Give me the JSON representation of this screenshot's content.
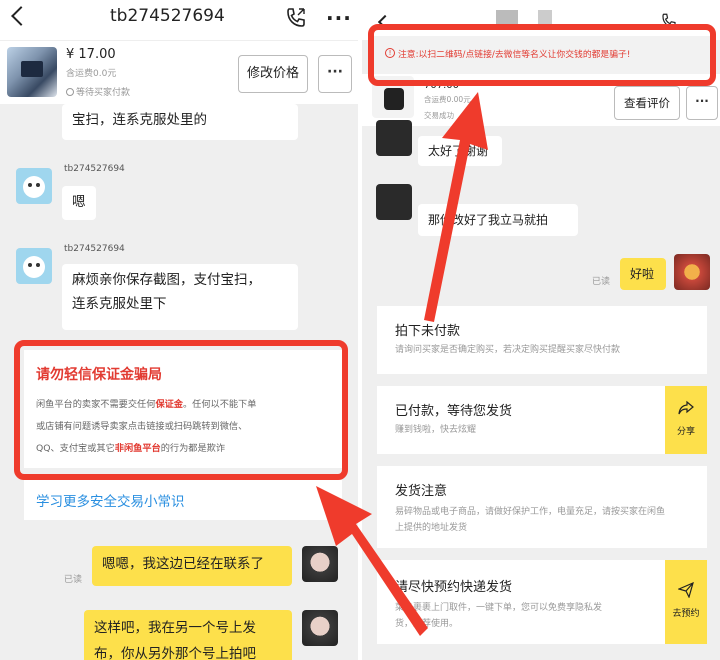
{
  "left": {
    "chat_title": "tb274527694",
    "product": {
      "price": "¥ 17.00",
      "shipping": "含运费0.0元",
      "status": "等待买家付款",
      "edit_price_label": "修改价格",
      "more_label": "···"
    },
    "messages": [
      {
        "text": "宝扫，连系克服处里的"
      },
      {
        "sender": "tb274527694",
        "text": "嗯"
      },
      {
        "sender": "tb274527694",
        "line1": "麻烦亲你保存截图，支付宝扫，",
        "line2": "连系克服处里下"
      }
    ],
    "warning": {
      "title": "请勿轻信保证金骗局",
      "line1_a": "闲鱼平台的卖家不需要交任何",
      "line1_b": "保证金",
      "line1_c": "。任何以不能下单",
      "line2": "或店铺有问题诱导卖家点击链接或扫码跳转到微信、",
      "line3_a": "QQ、支付宝或其它",
      "line3_b": "非闲鱼平台",
      "line3_c": "的行为都是欺诈"
    },
    "learn_more": "学习更多安全交易小常识",
    "my_messages": [
      {
        "read": "已读",
        "text": "嗯嗯，我这边已经在联系了"
      },
      {
        "line1": "这样吧，我在另一个号上发",
        "line2": "布，你从另外那个号上拍吧"
      }
    ]
  },
  "right": {
    "banner": "注意:以扫二维码/点链接/去微信等名义让你交钱的都是骗子!",
    "product": {
      "price": "707.00",
      "shipping": "含运费0.00元",
      "status": "交易成功",
      "review_label": "查看评价",
      "more_label": "···"
    },
    "messages": [
      {
        "text": "太好了谢谢"
      },
      {
        "text": "那你改好了我立马就拍"
      },
      {
        "read": "已读",
        "text": "好啦"
      }
    ],
    "cards": [
      {
        "title": "拍下未付款",
        "desc": "请询问买家是否确定购买，若决定购买提醒买家尽快付款"
      },
      {
        "title": "已付款，等待您发货",
        "desc": "赚到钱啦，快去炫耀",
        "action": "分享"
      },
      {
        "title": "发货注意",
        "desc1": "易碎物品或电子商品，请做好保护工作，电量充足，请按买家在闲鱼",
        "desc2": "上提供的地址发货"
      },
      {
        "title": "请尽快预约快递发货",
        "desc1": "菜鸟裹裹上门取件，一键下单，您可以免费享隐私发",
        "desc2": "货，推荐使用。",
        "action": "去预约"
      }
    ]
  },
  "colors": {
    "annotation_red": "#ef3b2c",
    "warning_red": "#e23b32",
    "bubble_yellow": "#fde04b",
    "link_blue": "#2a8fe0"
  }
}
